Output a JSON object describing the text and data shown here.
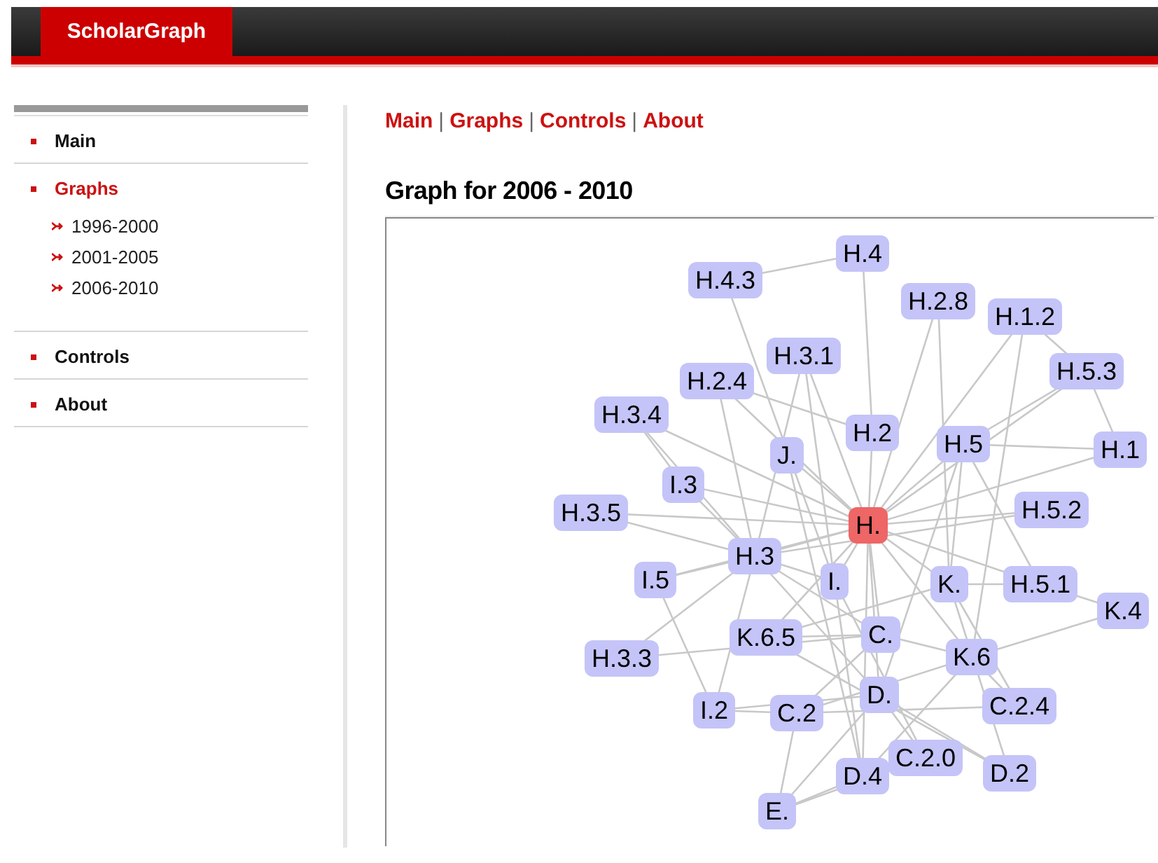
{
  "header": {
    "logo": "ScholarGraph"
  },
  "sidebar": {
    "items": [
      {
        "label": "Main",
        "selected": false
      },
      {
        "label": "Graphs",
        "selected": true,
        "children": [
          {
            "label": "1996-2000"
          },
          {
            "label": "2001-2005"
          },
          {
            "label": "2006-2010"
          }
        ]
      },
      {
        "label": "Controls",
        "selected": false
      },
      {
        "label": "About",
        "selected": false
      }
    ]
  },
  "nav": [
    {
      "kind": "link",
      "text": "Main"
    },
    {
      "kind": "separator",
      "text": "|"
    },
    {
      "kind": "link",
      "text": "Graphs"
    },
    {
      "kind": "separator",
      "text": "|"
    },
    {
      "kind": "link",
      "text": "Controls"
    },
    {
      "kind": "separator",
      "text": "|"
    },
    {
      "kind": "link",
      "text": "About"
    }
  ],
  "heading": "Graph for 2006 - 2010",
  "graph": {
    "nodes": [
      {
        "label": "H.4",
        "selected": false
      },
      {
        "label": "H.4.3",
        "selected": false
      },
      {
        "label": "H.2.8",
        "selected": false
      },
      {
        "label": "H.1.2",
        "selected": false
      },
      {
        "label": "H.3.1",
        "selected": false
      },
      {
        "label": "H.5.3",
        "selected": false
      },
      {
        "label": "H.2.4",
        "selected": false
      },
      {
        "label": "H.3.4",
        "selected": false
      },
      {
        "label": "H.2",
        "selected": false
      },
      {
        "label": "H.5",
        "selected": false
      },
      {
        "label": "J.",
        "selected": false
      },
      {
        "label": "H.1",
        "selected": false
      },
      {
        "label": "I.3",
        "selected": false
      },
      {
        "label": "H.5.2",
        "selected": false
      },
      {
        "label": "H.3.5",
        "selected": false
      },
      {
        "label": "H.",
        "selected": true
      },
      {
        "label": "H.3",
        "selected": false
      },
      {
        "label": "I.5",
        "selected": false
      },
      {
        "label": "I.",
        "selected": false
      },
      {
        "label": "K.",
        "selected": false
      },
      {
        "label": "H.5.1",
        "selected": false
      },
      {
        "label": "K.4",
        "selected": false
      },
      {
        "label": "C.",
        "selected": false
      },
      {
        "label": "K.6.5",
        "selected": false
      },
      {
        "label": "H.3.3",
        "selected": false
      },
      {
        "label": "K.6",
        "selected": false
      },
      {
        "label": "I.2",
        "selected": false
      },
      {
        "label": "C.2",
        "selected": false
      },
      {
        "label": "D.",
        "selected": false
      },
      {
        "label": "C.2.4",
        "selected": false
      },
      {
        "label": "C.2.0",
        "selected": false
      },
      {
        "label": "D.4",
        "selected": false
      },
      {
        "label": "D.2",
        "selected": false
      },
      {
        "label": "E.",
        "selected": false
      }
    ]
  }
}
